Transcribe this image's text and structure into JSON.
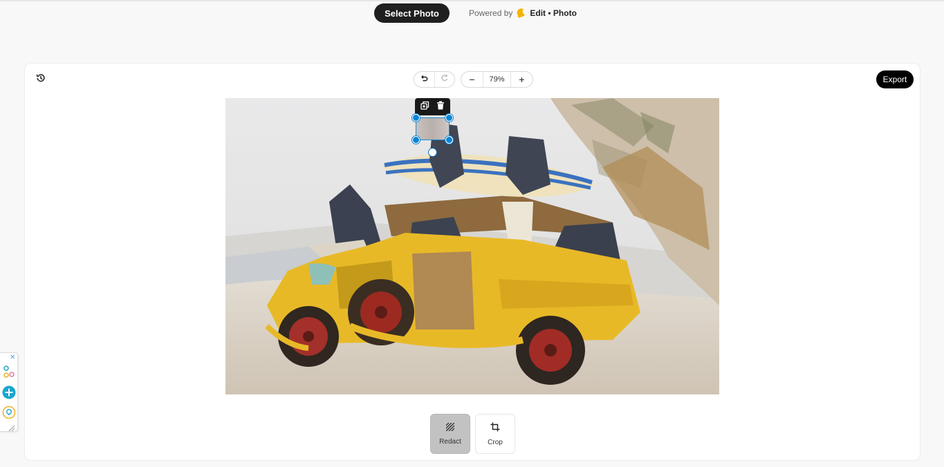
{
  "header": {
    "select_photo_label": "Select Photo",
    "powered_by_label": "Powered by",
    "brand_name": "Edit • Photo",
    "brand_icon": "sun-moon-logo-icon",
    "brand_color": "#f4b400"
  },
  "toolbar": {
    "history_icon": "history-icon",
    "undo_icon": "undo-icon",
    "redo_icon": "redo-icon",
    "zoom_out_label": "−",
    "zoom_level": "79%",
    "zoom_in_label": "+",
    "export_label": "Export"
  },
  "selection": {
    "duplicate_icon": "duplicate-icon",
    "delete_icon": "trash-icon",
    "selection_color": "#0b84d6"
  },
  "tools": [
    {
      "label": "Redact",
      "icon": "redact-hatch-icon",
      "active": true
    },
    {
      "label": "Crop",
      "icon": "crop-icon",
      "active": false
    }
  ],
  "side_widget": {
    "close_label": "✕",
    "items": [
      "shapes-icon",
      "add-circle-icon",
      "lightbulb-icon"
    ]
  },
  "colors": {
    "accent": "#0b84d6",
    "button_dark": "#1f1f1f",
    "active_tool": "#c2c2c2"
  }
}
